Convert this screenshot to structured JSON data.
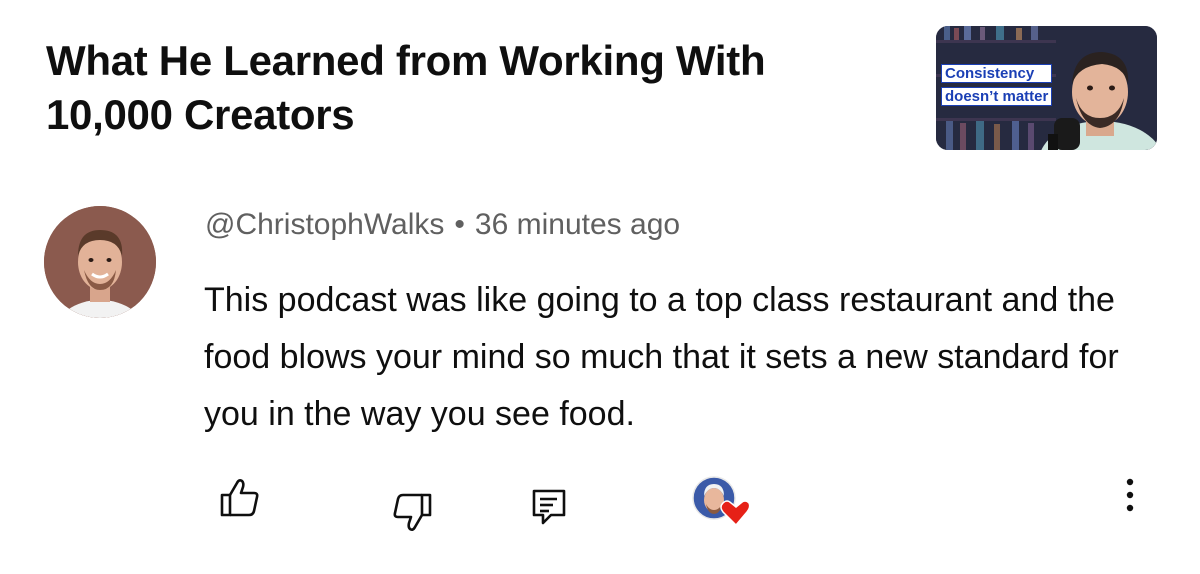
{
  "video": {
    "title": "What He Learned from Working With 10,000 Creators",
    "thumbnail": {
      "caption_line_1": "Consistency",
      "caption_line_2": "doesn’t matter"
    }
  },
  "comment": {
    "author": "@ChristophWalks",
    "separator": "•",
    "time": "36 minutes ago",
    "text": "This podcast was like going to a top class restaurant and the food blows your mind so much that it sets a new standard for you in the way you see food."
  },
  "actions": {
    "like_icon": "thumbs-up-icon",
    "dislike_icon": "thumbs-down-icon",
    "reply_icon": "reply-comment-icon",
    "creator_heart_icon": "creator-heart-icon",
    "more_icon": "more-vertical-icon"
  },
  "colors": {
    "heart": "#e62117",
    "meta_text": "#606060",
    "thumb_caption": "#1a3fb5"
  }
}
